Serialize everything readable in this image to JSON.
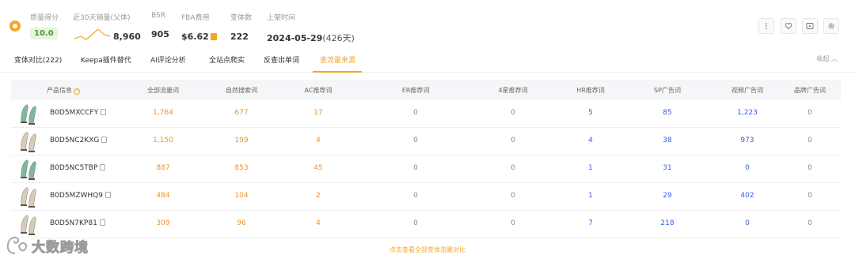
{
  "stats": {
    "score_label": "质量得分",
    "score_value": "10.0",
    "sales_label": "近30天销量(父体)",
    "sales_value": "8,960",
    "bsr_label": "BSR",
    "bsr_value": "905",
    "fba_label": "FBA费用",
    "fba_value": "$6.62",
    "variants_label": "变体数",
    "variants_value": "222",
    "listed_label": "上架时间",
    "listed_date": "2024-05-29",
    "listed_days": "(426天)"
  },
  "tabs": [
    {
      "label": "变体对比(222)",
      "active": false
    },
    {
      "label": "Keepa插件替代",
      "active": false
    },
    {
      "label": "AI评论分析",
      "active": false
    },
    {
      "label": "全站点爬实",
      "active": false
    },
    {
      "label": "反查出单词",
      "active": false
    },
    {
      "label": "查流量来源",
      "active": true
    }
  ],
  "collapse_label": "收起",
  "table": {
    "headers": [
      "产品信息",
      "全部流量词",
      "自然搜索词",
      "AC推荐词",
      "ER推荐词",
      "4星推荐词",
      "HR推荐词",
      "SP广告词",
      "视频广告词",
      "品牌广告词"
    ],
    "rows": [
      {
        "asin": "B0D5MXCCFY",
        "thumb_color": "#7fb89a",
        "values": [
          "1,764",
          "677",
          "17",
          "0",
          "0",
          "5",
          "85",
          "1,223",
          "0"
        ]
      },
      {
        "asin": "B0D5NC2KXG",
        "thumb_color": "#d9cbb5",
        "values": [
          "1,150",
          "199",
          "4",
          "0",
          "0",
          "4",
          "38",
          "973",
          "0"
        ]
      },
      {
        "asin": "B0D5NC5TBP",
        "thumb_color": "#7fb89a",
        "values": [
          "887",
          "853",
          "45",
          "0",
          "0",
          "1",
          "31",
          "0",
          "0"
        ]
      },
      {
        "asin": "B0D5MZWHQ9",
        "thumb_color": "#d9cbb5",
        "values": [
          "484",
          "104",
          "2",
          "0",
          "0",
          "1",
          "29",
          "402",
          "0"
        ]
      },
      {
        "asin": "B0D5N7KP81",
        "thumb_color": "#d9cbb5",
        "values": [
          "309",
          "96",
          "4",
          "0",
          "0",
          "7",
          "218",
          "0",
          "0"
        ]
      }
    ]
  },
  "footer_link": "点击查看全部变体流量对比",
  "watermark_text": "大数跨境",
  "colors": {
    "accent": "#f5a623",
    "orange_value": "#f0932b",
    "blue_value": "#3b5ee8",
    "score_bg": "#e5f6dd",
    "score_text": "#4a9a2e"
  },
  "icons": {
    "logo": "brand-logo-icon",
    "more": "more-vertical-icon",
    "favorite": "heart-icon",
    "video": "play-icon",
    "settings": "gear-icon"
  }
}
